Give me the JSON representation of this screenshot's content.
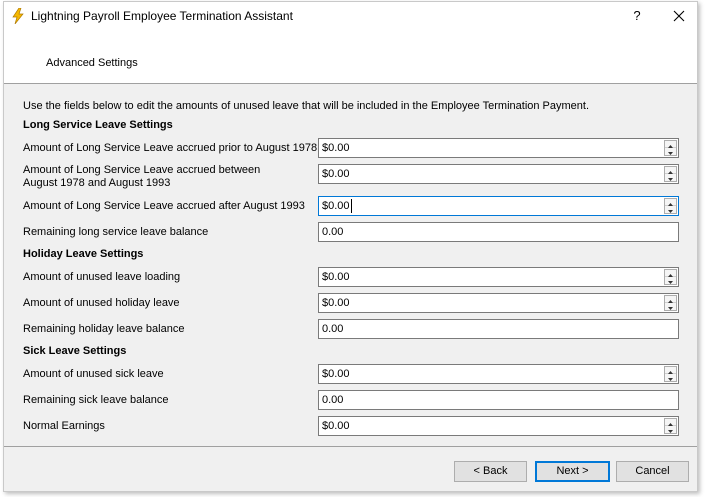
{
  "window": {
    "title": "Lightning Payroll Employee Termination Assistant",
    "help_label": "?"
  },
  "header": {
    "title": "Advanced Settings"
  },
  "intro": "Use the fields below to edit the amounts of unused leave that will be included in the Employee Termination Payment.",
  "sections": {
    "long_service": {
      "heading": "Long Service Leave Settings",
      "fields": [
        {
          "label": "Amount of Long Service Leave accrued prior to August 1978",
          "value": "$0.00"
        },
        {
          "label": "Amount of Long Service Leave accrued between",
          "label2": "August 1978 and August 1993",
          "value": "$0.00"
        },
        {
          "label": "Amount of Long Service Leave accrued after August 1993",
          "value": "$0.00"
        },
        {
          "label": "Remaining long service leave balance",
          "value": "0.00"
        }
      ]
    },
    "holiday": {
      "heading": "Holiday Leave Settings",
      "fields": [
        {
          "label": "Amount of unused leave loading",
          "value": "$0.00"
        },
        {
          "label": "Amount of unused holiday leave",
          "value": "$0.00"
        },
        {
          "label": "Remaining holiday leave balance",
          "value": "0.00"
        }
      ]
    },
    "sick": {
      "heading": "Sick Leave Settings",
      "fields": [
        {
          "label": "Amount of unused sick leave",
          "value": "$0.00"
        },
        {
          "label": "Remaining sick leave balance",
          "value": "0.00"
        },
        {
          "label": "Normal Earnings",
          "value": "$0.00"
        }
      ]
    }
  },
  "buttons": {
    "back": "< Back",
    "next": "Next >",
    "cancel": "Cancel"
  },
  "colors": {
    "focus": "#0078d7",
    "icon": "#f5b800"
  }
}
